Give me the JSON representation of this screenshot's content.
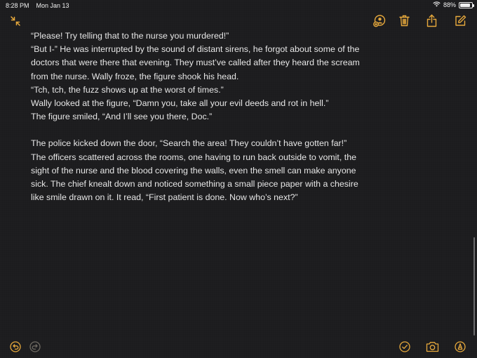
{
  "status_bar": {
    "time": "8:28 PM",
    "date": "Mon Jan 13",
    "battery_percent": "88%",
    "battery_level": 0.88
  },
  "toolbar_top": {
    "icons": [
      "collapse-icon",
      "share-people-icon",
      "trash-icon",
      "share-icon",
      "compose-icon"
    ]
  },
  "note": {
    "paragraph1": [
      "“Please! Try telling that to the nurse you murdered!”",
      "“But I-” He was interrupted by the sound of distant sirens, he forgot about some of the",
      "doctors that were there that evening. They must’ve called after they heard the scream",
      "from the nurse. Wally froze, the figure shook his head.",
      "“Tch, tch, the fuzz shows up at the worst of times.”",
      "Wally looked at the figure, “Damn you, take all your evil deeds and rot in hell.”",
      "The figure smiled, “And I’ll see you there, Doc.”"
    ],
    "paragraph2": [
      "The police kicked down the door, “Search the area! They couldn’t have gotten far!”",
      "The officers scattered across the rooms, one having to run back outside to vomit, the",
      "sight of the nurse and the blood covering the walls, even the smell can make anyone",
      "sick. The chief knealt down and noticed something a small piece paper with a chesire",
      "like smile drawn on it. It read, “First patient is done. Now who’s next?”"
    ]
  },
  "toolbar_bottom": {
    "icons": [
      "undo-icon",
      "redo-icon",
      "checklist-icon",
      "camera-icon",
      "markup-icon"
    ]
  },
  "colors": {
    "accent": "#e7a93c",
    "background": "#1c1c1e",
    "text": "#e6e6e6"
  }
}
